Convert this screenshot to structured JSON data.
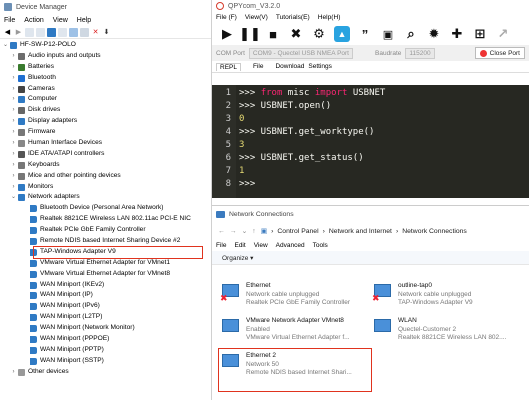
{
  "device_manager": {
    "title": "Device Manager",
    "menu": [
      "File",
      "Action",
      "View",
      "Help"
    ],
    "root": "HF-SW-P12-POLO",
    "categories": [
      {
        "label": "Audio inputs and outputs",
        "color": "#6d6d6d"
      },
      {
        "label": "Batteries",
        "color": "#3a7b2e"
      },
      {
        "label": "Bluetooth",
        "color": "#1f6fd1"
      },
      {
        "label": "Cameras",
        "color": "#444444"
      },
      {
        "label": "Computer",
        "color": "#2f7ac4"
      },
      {
        "label": "Disk drives",
        "color": "#666666"
      },
      {
        "label": "Display adapters",
        "color": "#2f7ac4"
      },
      {
        "label": "Firmware",
        "color": "#777777"
      },
      {
        "label": "Human Interface Devices",
        "color": "#888888"
      },
      {
        "label": "IDE ATA/ATAPI controllers",
        "color": "#555555"
      },
      {
        "label": "Keyboards",
        "color": "#777777"
      },
      {
        "label": "Mice and other pointing devices",
        "color": "#777777"
      },
      {
        "label": "Monitors",
        "color": "#2f7ac4"
      },
      {
        "label": "Network adapters",
        "color": "#2f7ac4"
      }
    ],
    "network_adapters": [
      "Bluetooth Device (Personal Area Network)",
      "Realtek 8821CE Wireless LAN 802.11ac PCI-E NIC",
      "Realtek PCIe GbE Family Controller",
      "Remote NDIS based Internet Sharing Device #2",
      "TAP-Windows Adapter V9",
      "VMware Virtual Ethernet Adapter for VMnet1",
      "VMware Virtual Ethernet Adapter for VMnet8",
      "WAN Miniport (IKEv2)",
      "WAN Miniport (IP)",
      "WAN Miniport (IPv6)",
      "WAN Miniport (L2TP)",
      "WAN Miniport (Network Monitor)",
      "WAN Miniport (PPPOE)",
      "WAN Miniport (PPTP)",
      "WAN Miniport (SSTP)"
    ],
    "other_devices": "Other devices"
  },
  "qpycom": {
    "title": "QPYcom_V3.2.0",
    "menu": [
      "File (F)",
      "View(V)",
      "Tutorials(E)",
      "Help(H)"
    ],
    "port_label": "COM Port",
    "port_value": "COM9 - Quectel USB NMEA Port",
    "baud_label": "Baudrate",
    "baud_value": "115200",
    "close_label": "Close Port",
    "tabs": [
      "REPL",
      "File",
      "Download",
      "Settings"
    ],
    "lines": [
      {
        "n": "1",
        "prompt": ">>> ",
        "kw1": "from",
        "mid": " misc ",
        "kw2": "import",
        "rest": " USBNET"
      },
      {
        "n": "2",
        "text": ">>> USBNET.open()"
      },
      {
        "n": "3",
        "out": "0"
      },
      {
        "n": "4",
        "text": ">>> USBNET.get_worktype()"
      },
      {
        "n": "5",
        "out": "3"
      },
      {
        "n": "6",
        "text": ">>> USBNET.get_status()"
      },
      {
        "n": "7",
        "out": "1"
      },
      {
        "n": "8",
        "text": ">>>"
      }
    ]
  },
  "network_connections": {
    "title": "Network Connections",
    "breadcrumb": [
      "Control Panel",
      "Network and Internet",
      "Network Connections"
    ],
    "menu": [
      "File",
      "Edit",
      "View",
      "Advanced",
      "Tools"
    ],
    "organize": "Organize ▾",
    "items": [
      {
        "name": "Ethernet",
        "line1": "Network cable unplugged",
        "line2": "Realtek PCIe GbE Family Controller",
        "x": true
      },
      {
        "name": "outline-tap0",
        "line1": "Network cable unplugged",
        "line2": "TAP-Windows Adapter V9",
        "x": true
      },
      {
        "name": "VMware Network Adapter VMnet8",
        "line1": "Enabled",
        "line2": "VMware Virtual Ethernet Adapter f...",
        "x": false
      },
      {
        "name": "WLAN",
        "line1": "Quectel-Customer 2",
        "line2": "Realtek 8821CE Wireless LAN 802....",
        "x": false
      },
      {
        "name": "Ethernet 2",
        "line1": "Network 50",
        "line2": "Remote NDIS based Internet Shari...",
        "x": false
      }
    ]
  }
}
